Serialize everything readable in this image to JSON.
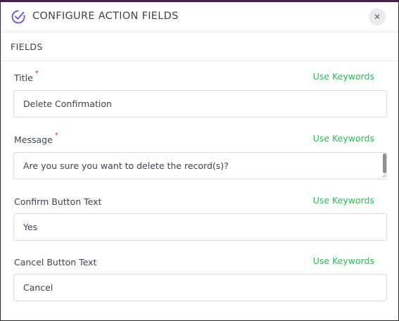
{
  "dialog": {
    "title": "CONFIGURE ACTION FIELDS",
    "close_icon_glyph": "✕",
    "accent_color": "#4a1d4f",
    "icon_color": "#6c4fd6"
  },
  "section": {
    "title": "FIELDS"
  },
  "fields": [
    {
      "label": "Title",
      "required_mark": "*",
      "keyword_link": "Use Keywords",
      "value": "Delete Confirmation"
    },
    {
      "label": "Message",
      "required_mark": "*",
      "keyword_link": "Use Keywords",
      "value": "Are you sure you want to delete the record(s)?"
    },
    {
      "label": "Confirm Button Text",
      "keyword_link": "Use Keywords",
      "value": "Yes"
    },
    {
      "label": "Cancel Button Text",
      "keyword_link": "Use Keywords",
      "value": "Cancel"
    }
  ],
  "colors": {
    "link_green": "#34b45a",
    "required_red": "#e0293a",
    "text_dark": "#3b4451",
    "border": "#d7dbe0"
  }
}
